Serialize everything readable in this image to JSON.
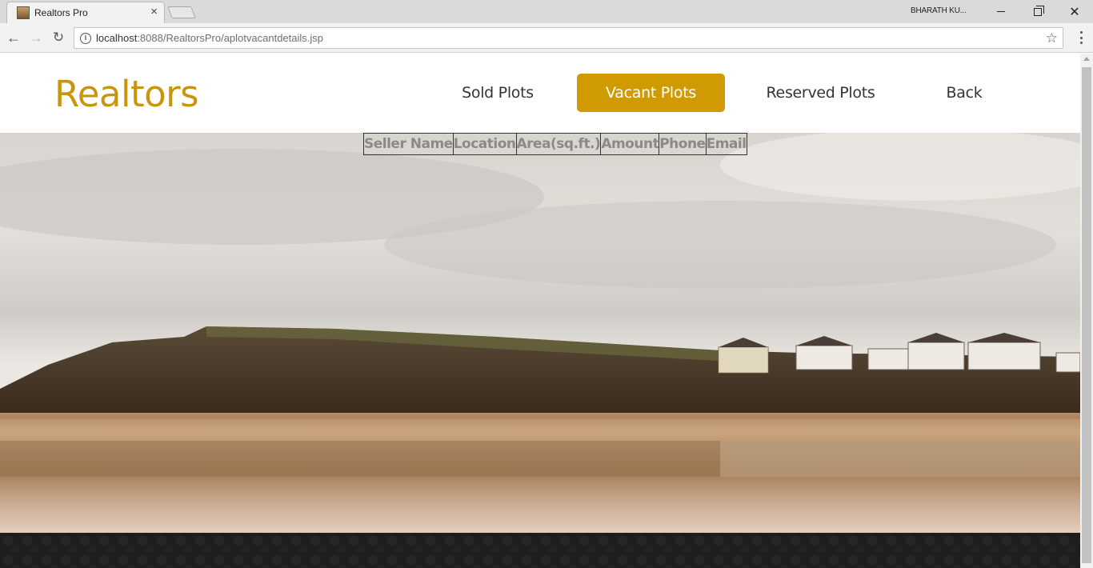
{
  "browser": {
    "tab_title": "Realtors Pro",
    "tab_close": "×",
    "user_name": "BHARATH KU...",
    "url_host": "localhost",
    "url_rest": ":8088/RealtorsPro/aplotvacantdetails.jsp",
    "icons": {
      "back": "←",
      "forward": "→",
      "reload": "↻",
      "info": "i",
      "star": "☆",
      "close": "✕"
    }
  },
  "header": {
    "logo": "Realtors",
    "nav": {
      "sold": "Sold Plots",
      "vacant": "Vacant Plots",
      "reserved": "Reserved Plots",
      "back": "Back"
    },
    "accent_color": "#cf9b00"
  },
  "table": {
    "columns": [
      "Seller Name",
      "Location",
      "Area(sq.ft.)",
      "Amount",
      "Phone",
      "Email"
    ]
  }
}
